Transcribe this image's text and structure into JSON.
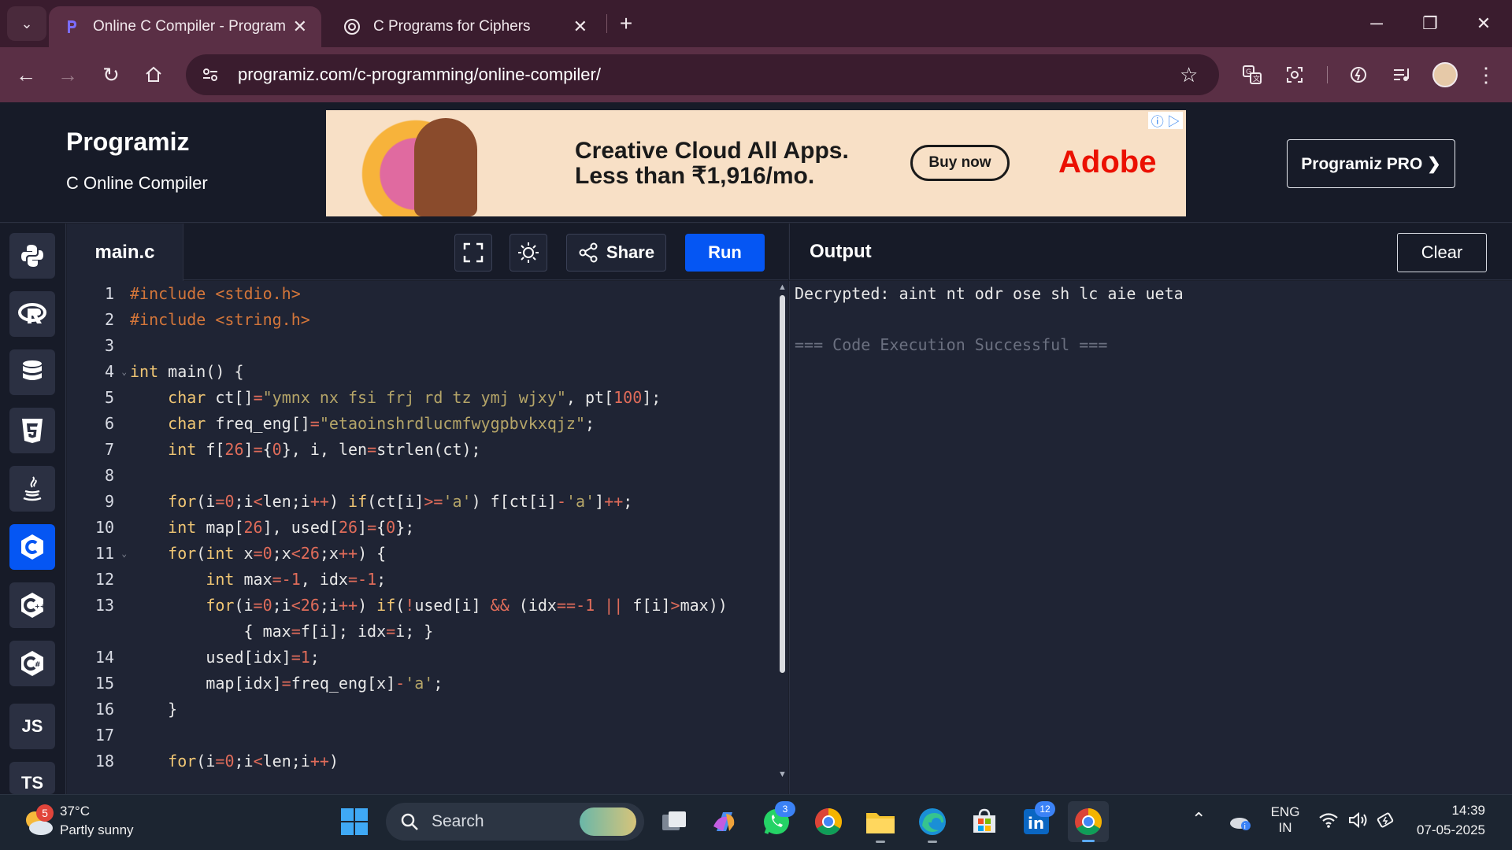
{
  "browser": {
    "tabs": [
      {
        "title": "Online C Compiler - Programiz",
        "active": true
      },
      {
        "title": "C Programs for Ciphers",
        "active": false
      }
    ],
    "new_tab_symbol": "+",
    "url": "programiz.com/c-programming/online-compiler/"
  },
  "site": {
    "logo": "Programiz",
    "subtitle": "C Online Compiler",
    "ad": {
      "headline_line1": "Creative Cloud All Apps.",
      "headline_line2": "Less than ₹1,916/mo.",
      "cta": "Buy now",
      "brand": "Adobe"
    },
    "pro_button": "Programiz PRO ❯"
  },
  "sidebar": {
    "items": [
      {
        "icon": "python-icon"
      },
      {
        "icon": "r-lang-icon"
      },
      {
        "icon": "database-icon"
      },
      {
        "icon": "html5-icon"
      },
      {
        "icon": "java-icon"
      },
      {
        "icon": "c-lang-icon",
        "active": true
      },
      {
        "icon": "cpp-icon"
      },
      {
        "icon": "csharp-icon"
      },
      {
        "label": "JS"
      },
      {
        "label": "TS"
      }
    ]
  },
  "editor": {
    "filename": "main.c",
    "share_label": "Share",
    "run_label": "Run",
    "line_numbers": [
      "1",
      "2",
      "3",
      "4",
      "5",
      "6",
      "7",
      "8",
      "9",
      "10",
      "11",
      "12",
      "13",
      "",
      "14",
      "15",
      "16",
      "17",
      "18"
    ],
    "lines": [
      "#include <stdio.h>",
      "#include <string.h>",
      "",
      "int main() {",
      "    char ct[]=\"ymnx nx fsi frj rd tz ymj wjxy\", pt[100];",
      "    char freq_eng[]=\"etaoinshrdlucmfwygpbvkxqjz\";",
      "    int f[26]={0}, i, len=strlen(ct);",
      "",
      "    for(i=0;i<len;i++) if(ct[i]>='a') f[ct[i]-'a']++;",
      "    int map[26], used[26]={0};",
      "    for(int x=0;x<26;x++) {",
      "        int max=-1, idx=-1;",
      "        for(i=0;i<26;i++) if(!used[i] && (idx==-1 || f[i]>max))",
      "            { max=f[i]; idx=i; }",
      "        used[idx]=1;",
      "        map[idx]=freq_eng[x]-'a';",
      "    }",
      "",
      "    for(i=0;i<len;i++)"
    ]
  },
  "output": {
    "title": "Output",
    "clear_label": "Clear",
    "lines": [
      "Decrypted: aint nt odr ose sh lc aie ueta",
      "",
      "",
      "=== Code Execution Successful ==="
    ]
  },
  "taskbar": {
    "weather_temp": "37°C",
    "weather_desc": "Partly sunny",
    "weather_badge": "5",
    "search_placeholder": "Search",
    "whatsapp_badge": "3",
    "linkedin_badge": "12",
    "lang_line1": "ENG",
    "lang_line2": "IN",
    "time": "14:39",
    "date": "07-05-2025"
  },
  "colors": {
    "accent": "#0556f3",
    "chrome_dark": "#3a1c2e",
    "chrome": "#5a2f45",
    "editor_bg": "#1f2434",
    "header_bg": "#171b28"
  }
}
